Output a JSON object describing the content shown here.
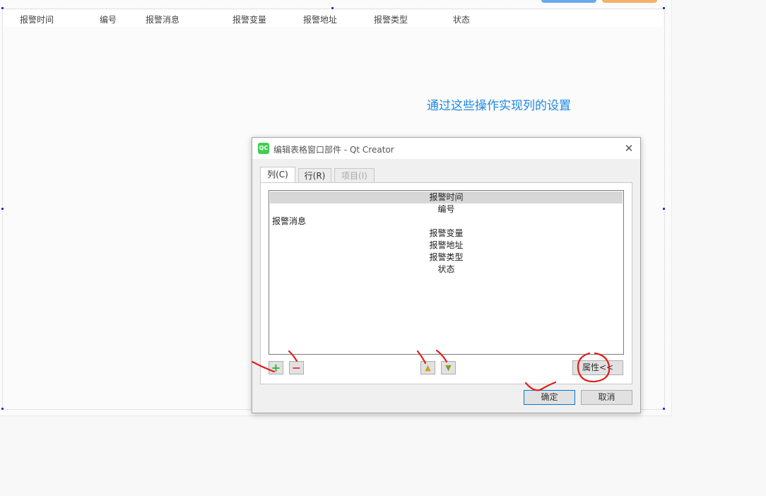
{
  "table": {
    "headers": [
      "报警时间",
      "编号",
      "报警消息",
      "报警变量",
      "报警地址",
      "报警类型",
      "状态"
    ]
  },
  "annotation": "通过这些操作实现列的设置",
  "colors": {
    "annotation": "#1e88e5",
    "qt_green": "#41cd52",
    "red_mark": "#e0201b"
  },
  "dialog": {
    "app_icon": "QC",
    "title": "编辑表格窗口部件 - Qt Creator",
    "close_icon": "close-icon",
    "tabs": [
      {
        "label": "列(C)",
        "active": true,
        "enabled": true
      },
      {
        "label": "行(R)",
        "active": false,
        "enabled": true
      },
      {
        "label": "项目(I)",
        "active": false,
        "enabled": false
      }
    ],
    "columns": [
      {
        "text": "报警时间",
        "selected": true,
        "align": "center"
      },
      {
        "text": "编号",
        "selected": false,
        "align": "center"
      },
      {
        "text": "报警消息",
        "selected": false,
        "align": "left"
      },
      {
        "text": "报警变量",
        "selected": false,
        "align": "center"
      },
      {
        "text": "报警地址",
        "selected": false,
        "align": "center"
      },
      {
        "text": "报警类型",
        "selected": false,
        "align": "center"
      },
      {
        "text": "状态",
        "selected": false,
        "align": "center"
      }
    ],
    "tools": {
      "add_icon": "plus-icon",
      "remove_icon": "minus-icon",
      "up_icon": "arrow-up-icon",
      "down_icon": "arrow-down-icon"
    },
    "properties_label": "属性<<",
    "ok_label": "确定",
    "cancel_label": "取消"
  }
}
